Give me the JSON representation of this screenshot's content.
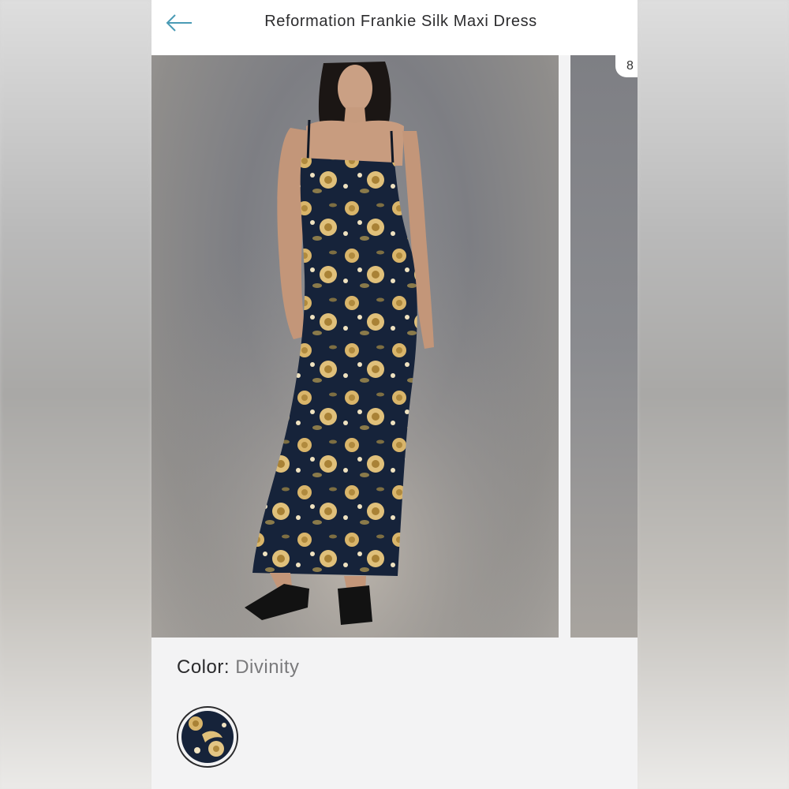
{
  "header": {
    "title": "Reformation Frankie Silk Maxi Dress",
    "back_icon": "arrow-left-icon",
    "accent_color": "#4a9bb5"
  },
  "gallery": {
    "counter_text": "8"
  },
  "color": {
    "label": "Color:",
    "value": "Divinity"
  },
  "colors": {
    "dress_navy": "#16233a",
    "floral_gold": "#d9b56a"
  }
}
